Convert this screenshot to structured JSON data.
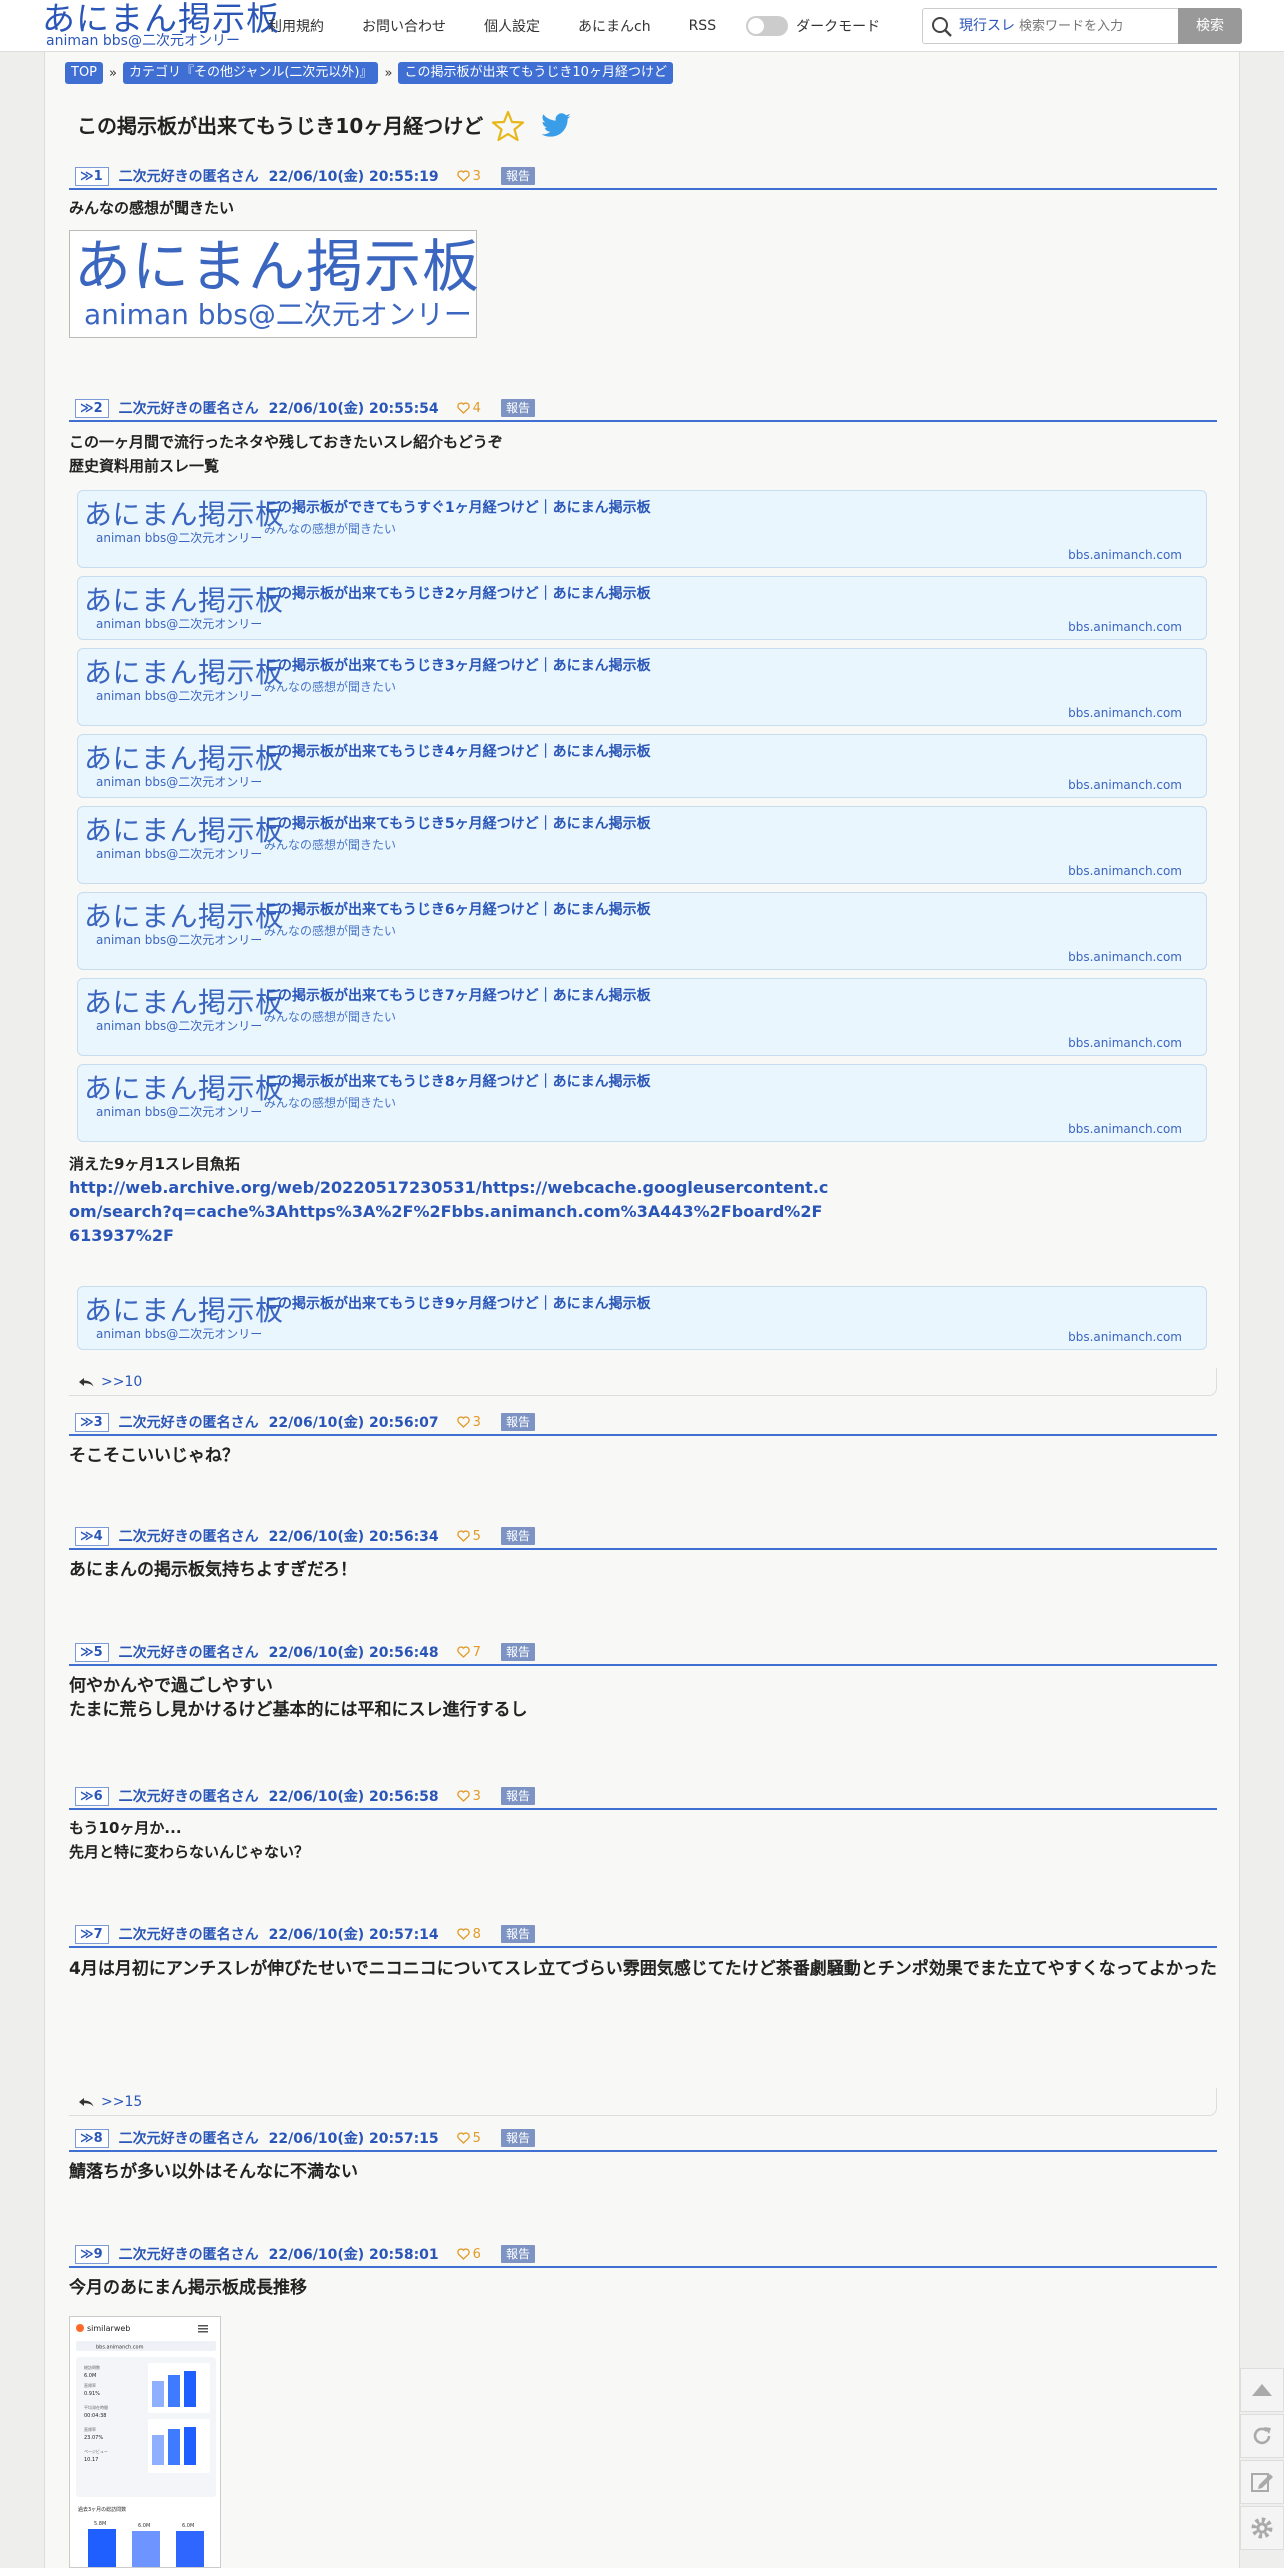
{
  "header": {
    "logo_main": "あにまん掲示板",
    "logo_sub": "animan bbs@二次元オンリー",
    "nav": [
      "利用規約",
      "お問い合わせ",
      "個人設定",
      "あにまんch",
      "RSS"
    ],
    "dark_mode_label": "ダークモード",
    "search_scope": "現行スレ",
    "search_placeholder": "検索ワードを入力",
    "search_button": "検索"
  },
  "breadcrumb": [
    "TOP",
    "カテゴリ『その他ジャンル(二次元以外)』",
    "この掲示板が出来てもうじき10ヶ月経つけど"
  ],
  "breadcrumb_sep": "»",
  "thread_title": "この掲示板が出来てもうじき10ヶ月経つけど",
  "report_label": "報告",
  "card_domain": "bbs.animanch.com",
  "card_logo_main": "あにまん掲示板",
  "card_logo_sub": "animan bbs@二次元オンリー",
  "posts": [
    {
      "num": "1",
      "name": "二次元好きの匿名さん",
      "date": "22/06/10(金) 20:55:19",
      "likes": "3",
      "lines": [
        "みんなの感想が聞きたい"
      ]
    },
    {
      "num": "2",
      "name": "二次元好きの匿名さん",
      "date": "22/06/10(金) 20:55:54",
      "likes": "4",
      "lines": [
        "この一ヶ月間で流行ったネタや残しておきたいスレ紹介もどうぞ",
        "歴史資料用前スレ一覧"
      ],
      "cards": [
        {
          "title": "この掲示板ができてもうすぐ1ヶ月経つけど｜あにまん掲示板",
          "desc": "みんなの感想が聞きたい"
        },
        {
          "title": "この掲示板が出来てもうじき2ヶ月経つけど｜あにまん掲示板",
          "desc": ""
        },
        {
          "title": "この掲示板が出来てもうじき3ヶ月経つけど｜あにまん掲示板",
          "desc": "みんなの感想が聞きたい"
        },
        {
          "title": "この掲示板が出来てもうじき4ヶ月経つけど｜あにまん掲示板",
          "desc": ""
        },
        {
          "title": "この掲示板が出来てもうじき5ヶ月経つけど｜あにまん掲示板",
          "desc": "みんなの感想が聞きたい"
        },
        {
          "title": "この掲示板が出来てもうじき6ヶ月経つけど｜あにまん掲示板",
          "desc": "みんなの感想が聞きたい"
        },
        {
          "title": "この掲示板が出来てもうじき7ヶ月経つけど｜あにまん掲示板",
          "desc": "みんなの感想が聞きたい"
        },
        {
          "title": "この掲示板が出来てもうじき8ヶ月経つけど｜あにまん掲示板",
          "desc": "みんなの感想が聞きたい"
        }
      ],
      "extra_line": "消えた9ヶ月1スレ目魚拓",
      "link": "http://web.archive.org/web/20220517230531/https://webcache.googleusercontent.com/search?q=cache%3Ahttps%3A%2F%2Fbbs.animanch.com%3A443%2Fboard%2F613937%2F",
      "link_card": {
        "title": "この掲示板が出来てもうじき9ヶ月経つけど｜あにまん掲示板"
      },
      "reply": ">>10"
    },
    {
      "num": "3",
      "name": "二次元好きの匿名さん",
      "date": "22/06/10(金) 20:56:07",
      "likes": "3",
      "lines": [
        "そこそこいいじゃね？"
      ]
    },
    {
      "num": "4",
      "name": "二次元好きの匿名さん",
      "date": "22/06/10(金) 20:56:34",
      "likes": "5",
      "lines": [
        "あにまんの掲示板気持ちよすぎだろ！"
      ]
    },
    {
      "num": "5",
      "name": "二次元好きの匿名さん",
      "date": "22/06/10(金) 20:56:48",
      "likes": "7",
      "lines": [
        "何やかんやで過ごしやすい",
        "たまに荒らし見かけるけど基本的には平和にスレ進行するし"
      ]
    },
    {
      "num": "6",
      "name": "二次元好きの匿名さん",
      "date": "22/06/10(金) 20:56:58",
      "likes": "3",
      "lines": [
        "もう10ヶ月か...",
        "先月と特に変わらないんじゃない？"
      ]
    },
    {
      "num": "7",
      "name": "二次元好きの匿名さん",
      "date": "22/06/10(金) 20:57:14",
      "likes": "8",
      "lines": [
        "4月は月初にアンチスレが伸びたせいでニコニコについてスレ立てづらい雰囲気感じてたけど茶番劇騒動とチンポ効果でまた立てやすくなってよかった"
      ],
      "reply": ">>15"
    },
    {
      "num": "8",
      "name": "二次元好きの匿名さん",
      "date": "22/06/10(金) 20:57:15",
      "likes": "5",
      "lines": [
        "鯖落ちが多い以外はそんなに不満ない"
      ]
    },
    {
      "num": "9",
      "name": "二次元好きの匿名さん",
      "date": "22/06/10(金) 20:58:01",
      "likes": "6",
      "lines": [
        "今月のあにまん掲示板成長推移"
      ]
    }
  ],
  "similarweb": {
    "brand": "similarweb",
    "domain": "bbs.animanch.com",
    "stats": [
      {
        "label": "総訪問数",
        "value": "6.0M"
      },
      {
        "label": "直帰率",
        "value": "0.91%"
      },
      {
        "label": "平均滞在時間",
        "value": "00:04:38"
      },
      {
        "label": "直帰率",
        "value": "23.07%"
      },
      {
        "label": "ページビュー",
        "value": "10.17"
      }
    ],
    "section": "過去3ヶ月の総訪問数",
    "bars": [
      "5.8M",
      "6.0M",
      "6.0M"
    ]
  },
  "colors": {
    "accent": "#3f6fd3",
    "link": "#2a56b8",
    "card_bg": "#eaf6fd",
    "like": "#e39a28",
    "report": "#7d93c3"
  }
}
